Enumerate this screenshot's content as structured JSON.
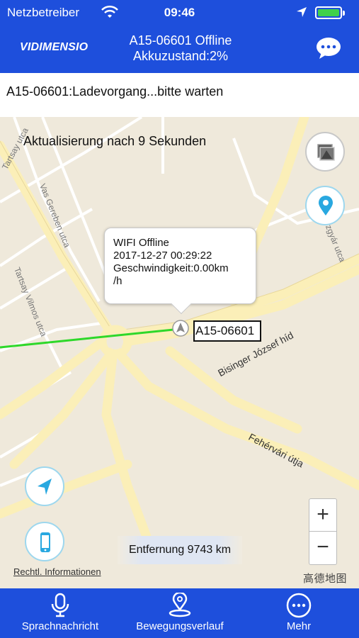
{
  "status_bar": {
    "carrier": "Netzbetreiber",
    "time": "09:46",
    "icons": [
      "wifi-icon",
      "location-arrow-icon",
      "battery-icon"
    ]
  },
  "header": {
    "brand": "VIDIMENSIO",
    "title_line1": "A15-06601  Offline",
    "title_line2": "Akkuzustand:2%",
    "chat_icon": "chat-bubble-icon"
  },
  "notice": "A15-06601:Ladevorgang...bitte warten",
  "map": {
    "update_text": "Aktualisierung nach 9 Sekunden",
    "popup": {
      "line1": "WIFI Offline",
      "line2": "2017-12-27 00:29:22",
      "line3": "Geschwindigkeit:0.00km",
      "line4": "/h"
    },
    "device_label": "A15-06601",
    "distance": "Entfernung 9743 km",
    "legal": "Rechtl. Informationen",
    "watermark": "高德地图",
    "zoom_in": "+",
    "zoom_out": "−",
    "streets": {
      "s1": "Vas Gereben utca",
      "s2": "Tartsay Vilmos utca",
      "s3": "Tartsay utca",
      "s4": "Bisinger József híd",
      "s5": "Fehérvári útja",
      "s6": "zgyár utca"
    },
    "colors": {
      "track": "#2ed82a",
      "road": "#fbefb8",
      "background": "#efe9db"
    }
  },
  "tabs": [
    {
      "label": "Sprachnachricht",
      "icon": "microphone-icon"
    },
    {
      "label": "Bewegungsverlauf",
      "icon": "route-pin-icon"
    },
    {
      "label": "Mehr",
      "icon": "more-dots-icon"
    }
  ],
  "theme": {
    "primary": "#1e4fdc"
  }
}
